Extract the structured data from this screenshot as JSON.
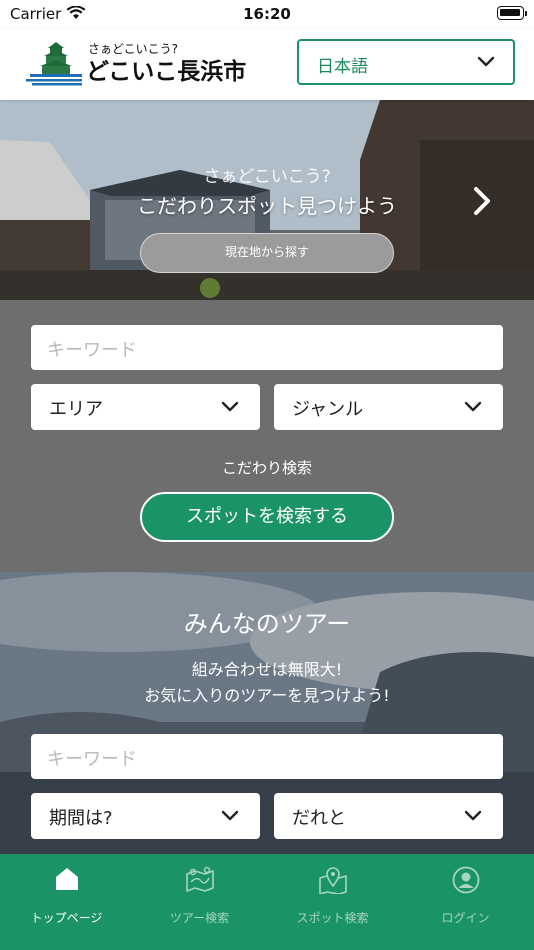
{
  "status_bar": {
    "carrier": "Carrier",
    "time": "16:20"
  },
  "header": {
    "logo_small": "さぁどこいこう?",
    "logo_main": "どこいこ長浜市",
    "language": "日本語"
  },
  "hero": {
    "line1": "さぁどこいこう?",
    "line2": "こだわりスポット見つけよう",
    "locate_button": "現在地から探す"
  },
  "spot_search": {
    "keyword_placeholder": "キーワード",
    "area_label": "エリア",
    "genre_label": "ジャンル",
    "kodawari_link": "こだわり検索",
    "search_button": "スポットを検索する"
  },
  "tour_search": {
    "title": "みんなのツアー",
    "subtitle_line1": "組み合わせは無限大!",
    "subtitle_line2": "お気に入りのツアーを見つけよう!",
    "keyword_placeholder": "キーワード",
    "period_label": "期間は?",
    "companion_label": "だれと"
  },
  "tab_bar": {
    "items": [
      {
        "label": "トップページ",
        "icon": "home-icon",
        "active": true
      },
      {
        "label": "ツアー検索",
        "icon": "tour-map-icon",
        "active": false
      },
      {
        "label": "スポット検索",
        "icon": "spot-map-icon",
        "active": false
      },
      {
        "label": "ログイン",
        "icon": "user-icon",
        "active": false
      }
    ]
  },
  "colors": {
    "brand_green": "#1a9466",
    "panel_gray": "#6e6e6e"
  }
}
